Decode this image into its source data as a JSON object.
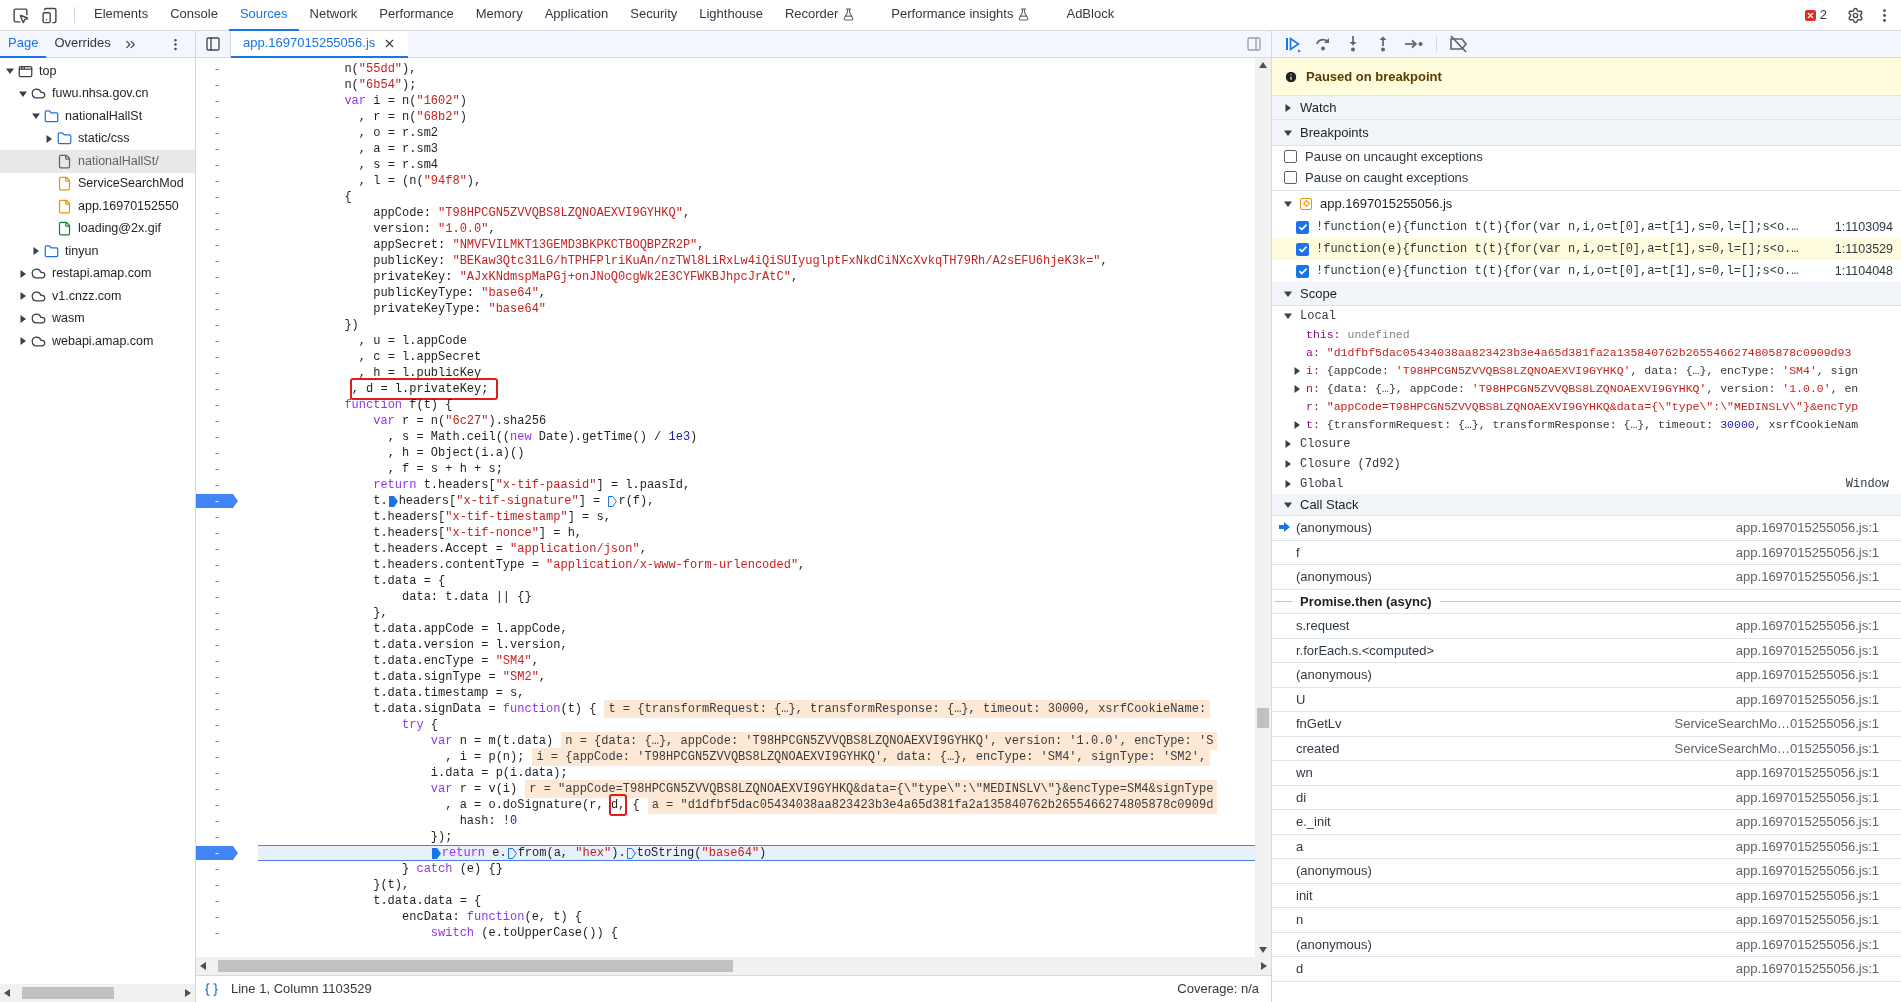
{
  "toolbar": {
    "tabs": [
      {
        "label": "Elements",
        "selected": false,
        "experimental": false
      },
      {
        "label": "Console",
        "selected": false,
        "experimental": false
      },
      {
        "label": "Sources",
        "selected": true,
        "experimental": false
      },
      {
        "label": "Network",
        "selected": false,
        "experimental": false
      },
      {
        "label": "Performance",
        "selected": false,
        "experimental": false
      },
      {
        "label": "Memory",
        "selected": false,
        "experimental": false
      },
      {
        "label": "Application",
        "selected": false,
        "experimental": false
      },
      {
        "label": "Security",
        "selected": false,
        "experimental": false
      },
      {
        "label": "Lighthouse",
        "selected": false,
        "experimental": false
      },
      {
        "label": "Recorder",
        "selected": false,
        "experimental": true
      },
      {
        "label": "Performance insights",
        "selected": false,
        "experimental": true
      },
      {
        "label": "AdBlock",
        "selected": false,
        "experimental": false
      }
    ],
    "error_count": "2"
  },
  "navigator": {
    "tabs": [
      {
        "label": "Page",
        "selected": true
      },
      {
        "label": "Overrides",
        "selected": false
      }
    ],
    "tree": [
      {
        "label": "top",
        "kind": "frame",
        "expanded": true,
        "selected": false,
        "children": [
          {
            "label": "fuwu.nhsa.gov.cn",
            "kind": "domain",
            "expanded": true,
            "selected": false,
            "children": [
              {
                "label": "nationalHallSt",
                "kind": "folder",
                "expanded": true,
                "selected": false,
                "children": [
                  {
                    "label": "static/css",
                    "kind": "folder",
                    "expanded": false,
                    "selected": false
                  },
                  {
                    "label": "nationalHallSt/",
                    "kind": "file",
                    "color": "#5f6368",
                    "selected": true
                  },
                  {
                    "label": "ServiceSearchMod",
                    "kind": "file",
                    "color": "#e8910c",
                    "selected": false
                  },
                  {
                    "label": "app.16970152550",
                    "kind": "file",
                    "color": "#e8910c",
                    "selected": false
                  },
                  {
                    "label": "loading@2x.gif",
                    "kind": "file",
                    "color": "#188038",
                    "selected": false
                  }
                ]
              },
              {
                "label": "tinyun",
                "kind": "folder",
                "expanded": false,
                "selected": false
              }
            ]
          },
          {
            "label": "restapi.amap.com",
            "kind": "domain",
            "expanded": false,
            "selected": false
          },
          {
            "label": "v1.cnzz.com",
            "kind": "domain",
            "expanded": false,
            "selected": false
          },
          {
            "label": "wasm",
            "kind": "domain",
            "expanded": false,
            "selected": false
          },
          {
            "label": "webapi.amap.com",
            "kind": "domain",
            "expanded": false,
            "selected": false
          }
        ]
      }
    ]
  },
  "editor": {
    "file_tab": "app.1697015255056.js",
    "status": "Line 1, Column 1103529",
    "coverage": "Coverage: n/a",
    "lines": [
      {
        "gutter": "-",
        "breakpoint": false,
        "current": false,
        "tokens": [
          {
            "kind": "plain",
            "text": "            n("
          },
          {
            "kind": "string",
            "text": "\"55dd\""
          },
          {
            "kind": "plain",
            "text": "),"
          }
        ]
      },
      {
        "gutter": "-",
        "breakpoint": false,
        "current": false,
        "tokens": [
          {
            "kind": "plain",
            "text": "            n("
          },
          {
            "kind": "string",
            "text": "\"6b54\""
          },
          {
            "kind": "plain",
            "text": ");"
          }
        ]
      },
      {
        "gutter": "-",
        "breakpoint": false,
        "current": false,
        "tokens": [
          {
            "kind": "keyword",
            "text": "            var"
          },
          {
            "kind": "plain",
            "text": " i = n("
          },
          {
            "kind": "string",
            "text": "\"1602\""
          },
          {
            "kind": "plain",
            "text": ")"
          }
        ]
      },
      {
        "gutter": "-",
        "breakpoint": false,
        "current": false,
        "tokens": [
          {
            "kind": "plain",
            "text": "              , r = n("
          },
          {
            "kind": "string",
            "text": "\"68b2\""
          },
          {
            "kind": "plain",
            "text": ")"
          }
        ]
      },
      {
        "gutter": "-",
        "breakpoint": false,
        "current": false,
        "tokens": [
          {
            "kind": "plain",
            "text": "              , o = r.sm2"
          }
        ]
      },
      {
        "gutter": "-",
        "breakpoint": false,
        "current": false,
        "tokens": [
          {
            "kind": "plain",
            "text": "              , a = r.sm3"
          }
        ]
      },
      {
        "gutter": "-",
        "breakpoint": false,
        "current": false,
        "tokens": [
          {
            "kind": "plain",
            "text": "              , s = r.sm4"
          }
        ]
      },
      {
        "gutter": "-",
        "breakpoint": false,
        "current": false,
        "tokens": [
          {
            "kind": "plain",
            "text": "              , l = (n("
          },
          {
            "kind": "string",
            "text": "\"94f8\""
          },
          {
            "kind": "plain",
            "text": "),"
          }
        ]
      },
      {
        "gutter": "-",
        "breakpoint": false,
        "current": false,
        "tokens": [
          {
            "kind": "plain",
            "text": "            {"
          }
        ]
      },
      {
        "gutter": "-",
        "breakpoint": false,
        "current": false,
        "tokens": [
          {
            "kind": "plain",
            "text": "                appCode: "
          },
          {
            "kind": "string",
            "text": "\"T98HPCGN5ZVVQBS8LZQNOAEXVI9GYHKQ\""
          },
          {
            "kind": "plain",
            "text": ","
          }
        ]
      },
      {
        "gutter": "-",
        "breakpoint": false,
        "current": false,
        "tokens": [
          {
            "kind": "plain",
            "text": "                version: "
          },
          {
            "kind": "string",
            "text": "\"1.0.0\""
          },
          {
            "kind": "plain",
            "text": ","
          }
        ]
      },
      {
        "gutter": "-",
        "breakpoint": false,
        "current": false,
        "tokens": [
          {
            "kind": "plain",
            "text": "                appSecret: "
          },
          {
            "kind": "string",
            "text": "\"NMVFVILMKT13GEMD3BKPKCTBOQBPZR2P\""
          },
          {
            "kind": "plain",
            "text": ","
          }
        ]
      },
      {
        "gutter": "-",
        "breakpoint": false,
        "current": false,
        "tokens": [
          {
            "kind": "plain",
            "text": "                publicKey: "
          },
          {
            "kind": "string",
            "text": "\"BEKaw3Qtc31LG/hTPHFPlriKuAn/nzTWl8LiRxLw4iQiSUIyuglptFxNkdCiNXcXvkqTH79Rh/A2sEFU6hjeK3k=\""
          },
          {
            "kind": "plain",
            "text": ","
          }
        ]
      },
      {
        "gutter": "-",
        "breakpoint": false,
        "current": false,
        "tokens": [
          {
            "kind": "plain",
            "text": "                privateKey: "
          },
          {
            "kind": "string",
            "text": "\"AJxKNdmspMaPGj+onJNoQ0cgWk2E3CYFWKBJhpcJrAtC\""
          },
          {
            "kind": "plain",
            "text": ","
          }
        ]
      },
      {
        "gutter": "-",
        "breakpoint": false,
        "current": false,
        "tokens": [
          {
            "kind": "plain",
            "text": "                publicKeyType: "
          },
          {
            "kind": "string",
            "text": "\"base64\""
          },
          {
            "kind": "plain",
            "text": ","
          }
        ]
      },
      {
        "gutter": "-",
        "breakpoint": false,
        "current": false,
        "tokens": [
          {
            "kind": "plain",
            "text": "                privateKeyType: "
          },
          {
            "kind": "string",
            "text": "\"base64\""
          }
        ]
      },
      {
        "gutter": "-",
        "breakpoint": false,
        "current": false,
        "tokens": [
          {
            "kind": "plain",
            "text": "            })"
          }
        ]
      },
      {
        "gutter": "-",
        "breakpoint": false,
        "current": false,
        "tokens": [
          {
            "kind": "plain",
            "text": "              , u = l.appCode"
          }
        ]
      },
      {
        "gutter": "-",
        "breakpoint": false,
        "current": false,
        "tokens": [
          {
            "kind": "plain",
            "text": "              , c = l.appSecret"
          }
        ]
      },
      {
        "gutter": "-",
        "breakpoint": false,
        "current": false,
        "tokens": [
          {
            "kind": "plain",
            "text": "              , h = l.publicKey"
          }
        ]
      },
      {
        "gutter": "-",
        "breakpoint": false,
        "current": false,
        "tokens": [
          {
            "kind": "plain",
            "text": "             , d = l.privateKey; ",
            "boxed": true
          }
        ]
      },
      {
        "gutter": "-",
        "breakpoint": false,
        "current": false,
        "tokens": [
          {
            "kind": "keyword",
            "text": "            function"
          },
          {
            "kind": "plain",
            "text": " f(t) {"
          }
        ]
      },
      {
        "gutter": "-",
        "breakpoint": false,
        "current": false,
        "tokens": [
          {
            "kind": "keyword",
            "text": "                var"
          },
          {
            "kind": "plain",
            "text": " r = n("
          },
          {
            "kind": "string",
            "text": "\"6c27\""
          },
          {
            "kind": "plain",
            "text": ").sha256"
          }
        ]
      },
      {
        "gutter": "-",
        "breakpoint": false,
        "current": false,
        "tokens": [
          {
            "kind": "plain",
            "text": "                  , s = Math.ceil(("
          },
          {
            "kind": "keyword",
            "text": "new"
          },
          {
            "kind": "plain",
            "text": " Date).getTime() / "
          },
          {
            "kind": "number",
            "text": "1e3"
          },
          {
            "kind": "plain",
            "text": ")"
          }
        ]
      },
      {
        "gutter": "-",
        "breakpoint": false,
        "current": false,
        "tokens": [
          {
            "kind": "plain",
            "text": "                  , h = Object(i.a)()"
          }
        ]
      },
      {
        "gutter": "-",
        "breakpoint": false,
        "current": false,
        "tokens": [
          {
            "kind": "plain",
            "text": "                  , f = s + h + s;"
          }
        ]
      },
      {
        "gutter": "-",
        "breakpoint": false,
        "current": false,
        "tokens": [
          {
            "kind": "keyword",
            "text": "                return"
          },
          {
            "kind": "plain",
            "text": " t.headers["
          },
          {
            "kind": "string",
            "text": "\"x-tif-paasid\""
          },
          {
            "kind": "plain",
            "text": "] = l.paasId,"
          }
        ]
      },
      {
        "gutter": "-",
        "breakpoint": true,
        "current": false,
        "tokens": [
          {
            "kind": "plain",
            "text": "                t."
          },
          {
            "kind": "plain",
            "text": "headers[",
            "marker": {
              "active": true
            }
          },
          {
            "kind": "string",
            "text": "\"x-tif-signature\""
          },
          {
            "kind": "plain",
            "text": "] = "
          },
          {
            "kind": "plain",
            "text": "r(f),",
            "marker": {
              "active": false
            }
          }
        ]
      },
      {
        "gutter": "-",
        "breakpoint": false,
        "current": false,
        "tokens": [
          {
            "kind": "plain",
            "text": "                t.headers["
          },
          {
            "kind": "string",
            "text": "\"x-tif-timestamp\""
          },
          {
            "kind": "plain",
            "text": "] = s,"
          }
        ]
      },
      {
        "gutter": "-",
        "breakpoint": false,
        "current": false,
        "tokens": [
          {
            "kind": "plain",
            "text": "                t.headers["
          },
          {
            "kind": "string",
            "text": "\"x-tif-nonce\""
          },
          {
            "kind": "plain",
            "text": "] = h,"
          }
        ]
      },
      {
        "gutter": "-",
        "breakpoint": false,
        "current": false,
        "tokens": [
          {
            "kind": "plain",
            "text": "                t.headers.Accept = "
          },
          {
            "kind": "string",
            "text": "\"application/json\""
          },
          {
            "kind": "plain",
            "text": ","
          }
        ]
      },
      {
        "gutter": "-",
        "breakpoint": false,
        "current": false,
        "tokens": [
          {
            "kind": "plain",
            "text": "                t.headers.contentType = "
          },
          {
            "kind": "string",
            "text": "\"application/x-www-form-urlencoded\""
          },
          {
            "kind": "plain",
            "text": ","
          }
        ]
      },
      {
        "gutter": "-",
        "breakpoint": false,
        "current": false,
        "tokens": [
          {
            "kind": "plain",
            "text": "                t.data = {"
          }
        ]
      },
      {
        "gutter": "-",
        "breakpoint": false,
        "current": false,
        "tokens": [
          {
            "kind": "plain",
            "text": "                    data: t.data || {}"
          }
        ]
      },
      {
        "gutter": "-",
        "breakpoint": false,
        "current": false,
        "tokens": [
          {
            "kind": "plain",
            "text": "                },"
          }
        ]
      },
      {
        "gutter": "-",
        "breakpoint": false,
        "current": false,
        "tokens": [
          {
            "kind": "plain",
            "text": "                t.data.appCode = l.appCode,"
          }
        ]
      },
      {
        "gutter": "-",
        "breakpoint": false,
        "current": false,
        "tokens": [
          {
            "kind": "plain",
            "text": "                t.data.version = l.version,"
          }
        ]
      },
      {
        "gutter": "-",
        "breakpoint": false,
        "current": false,
        "tokens": [
          {
            "kind": "plain",
            "text": "                t.data.encType = "
          },
          {
            "kind": "string",
            "text": "\"SM4\""
          },
          {
            "kind": "plain",
            "text": ","
          }
        ]
      },
      {
        "gutter": "-",
        "breakpoint": false,
        "current": false,
        "tokens": [
          {
            "kind": "plain",
            "text": "                t.data.signType = "
          },
          {
            "kind": "string",
            "text": "\"SM2\""
          },
          {
            "kind": "plain",
            "text": ","
          }
        ]
      },
      {
        "gutter": "-",
        "breakpoint": false,
        "current": false,
        "tokens": [
          {
            "kind": "plain",
            "text": "                t.data.timestamp = s,"
          }
        ]
      },
      {
        "gutter": "-",
        "breakpoint": false,
        "current": false,
        "tokens": [
          {
            "kind": "plain",
            "text": "                t.data.signData = "
          },
          {
            "kind": "keyword",
            "text": "function"
          },
          {
            "kind": "plain",
            "text": "(t) {"
          },
          {
            "kind": "value",
            "text": "t = {transformRequest: {…}, transformResponse: {…}, timeout: 30000, xsrfCookieName:"
          }
        ]
      },
      {
        "gutter": "-",
        "breakpoint": false,
        "current": false,
        "tokens": [
          {
            "kind": "keyword",
            "text": "                    try"
          },
          {
            "kind": "plain",
            "text": " {"
          }
        ]
      },
      {
        "gutter": "-",
        "breakpoint": false,
        "current": false,
        "tokens": [
          {
            "kind": "keyword",
            "text": "                        var"
          },
          {
            "kind": "plain",
            "text": " n = m(t.data)"
          },
          {
            "kind": "value",
            "text": "n = {data: {…}, appCode: 'T98HPCGN5ZVVQBS8LZQNOAEXVI9GYHKQ', version: '1.0.0', encType: 'S"
          }
        ]
      },
      {
        "gutter": "-",
        "breakpoint": false,
        "current": false,
        "tokens": [
          {
            "kind": "plain",
            "text": "                          , i = p(n);"
          },
          {
            "kind": "value",
            "text": "i = {appCode: 'T98HPCGN5ZVVQBS8LZQNOAEXVI9GYHKQ', data: {…}, encType: 'SM4', signType: 'SM2',"
          }
        ]
      },
      {
        "gutter": "-",
        "breakpoint": false,
        "current": false,
        "tokens": [
          {
            "kind": "plain",
            "text": "                        i.data = p(i.data);"
          }
        ]
      },
      {
        "gutter": "-",
        "breakpoint": false,
        "current": false,
        "tokens": [
          {
            "kind": "keyword",
            "text": "                        var"
          },
          {
            "kind": "plain",
            "text": " r = v(i)"
          },
          {
            "kind": "value",
            "text": "r = \"appCode=T98HPCGN5ZVVQBS8LZQNOAEXVI9GYHKQ&data={\\\"type\\\":\\\"MEDINSLV\\\"}&encType=SM4&signType"
          }
        ]
      },
      {
        "gutter": "-",
        "breakpoint": false,
        "current": false,
        "tokens": [
          {
            "kind": "plain",
            "text": "                          , a = o.doSignature(r, "
          },
          {
            "kind": "plain",
            "text": "d,",
            "boxed": true
          },
          {
            "kind": "plain",
            "text": " {"
          },
          {
            "kind": "value",
            "text": "a = \"d1dfbf5dac05434038aa823423b3e4a65d381fa2a135840762b2655466274805878c0909d"
          }
        ]
      },
      {
        "gutter": "-",
        "breakpoint": false,
        "current": false,
        "tokens": [
          {
            "kind": "plain",
            "text": "                            hash: !"
          },
          {
            "kind": "number",
            "text": "0"
          }
        ]
      },
      {
        "gutter": "-",
        "breakpoint": false,
        "current": false,
        "tokens": [
          {
            "kind": "plain",
            "text": "                        });"
          }
        ]
      },
      {
        "gutter": "-",
        "breakpoint": true,
        "current": true,
        "tokens": [
          {
            "kind": "keyword",
            "text": "                        return",
            "marker": {
              "active": true
            }
          },
          {
            "kind": "plain",
            "text": " e."
          },
          {
            "kind": "plain",
            "text": "from(a, ",
            "marker": {
              "active": false
            }
          },
          {
            "kind": "string",
            "text": "\"hex\""
          },
          {
            "kind": "plain",
            "text": ")."
          },
          {
            "kind": "plain",
            "text": "toString(",
            "marker": {
              "active": false
            }
          },
          {
            "kind": "string",
            "text": "\"base64\""
          },
          {
            "kind": "plain",
            "text": ")"
          }
        ]
      },
      {
        "gutter": "-",
        "breakpoint": false,
        "current": false,
        "tokens": [
          {
            "kind": "plain",
            "text": "                    } "
          },
          {
            "kind": "keyword",
            "text": "catch"
          },
          {
            "kind": "plain",
            "text": " (e) {}"
          }
        ]
      },
      {
        "gutter": "-",
        "breakpoint": false,
        "current": false,
        "tokens": [
          {
            "kind": "plain",
            "text": "                }(t),"
          }
        ]
      },
      {
        "gutter": "-",
        "breakpoint": false,
        "current": false,
        "tokens": [
          {
            "kind": "plain",
            "text": "                t.data.data = {"
          }
        ]
      },
      {
        "gutter": "-",
        "breakpoint": false,
        "current": false,
        "tokens": [
          {
            "kind": "plain",
            "text": "                    encData: "
          },
          {
            "kind": "keyword",
            "text": "function"
          },
          {
            "kind": "plain",
            "text": "(e, t) {"
          }
        ]
      },
      {
        "gutter": "-",
        "breakpoint": false,
        "current": false,
        "tokens": [
          {
            "kind": "keyword",
            "text": "                        switch"
          },
          {
            "kind": "plain",
            "text": " (e.toUpperCase()) {"
          }
        ]
      }
    ]
  },
  "debugger": {
    "banner": "Paused on breakpoint",
    "watch": {
      "label": "Watch",
      "expanded": false
    },
    "breakpoints": {
      "label": "Breakpoints",
      "expanded": true,
      "options": [
        {
          "label": "Pause on uncaught exceptions",
          "checked": false
        },
        {
          "label": "Pause on caught exceptions",
          "checked": false
        }
      ],
      "file": {
        "label": "app.1697015255056.js",
        "expanded": true
      },
      "items": [
        {
          "code": "!function(e){function t(t){for(var n,i,o=t[0],a=t[1],s=0,l=[];s<o.…",
          "location": "1:1103094",
          "checked": true,
          "selected": false
        },
        {
          "code": "!function(e){function t(t){for(var n,i,o=t[0],a=t[1],s=0,l=[];s<o.…",
          "location": "1:1103529",
          "checked": true,
          "selected": true
        },
        {
          "code": "!function(e){function t(t){for(var n,i,o=t[0],a=t[1],s=0,l=[];s<o.…",
          "location": "1:1104048",
          "checked": true,
          "selected": false
        }
      ]
    },
    "scope": {
      "label": "Scope",
      "expanded": true,
      "groups": [
        {
          "label": "Local",
          "expanded": true,
          "variables": [
            {
              "name": "this:",
              "kind": "primitive",
              "value": [
                {
                  "kind": "muted",
                  "text": "undefined"
                }
              ]
            },
            {
              "name": "a:",
              "kind": "primitive",
              "value": [
                {
                  "kind": "string",
                  "text": "\"d1dfbf5dac05434038aa823423b3e4a65d381fa2a135840762b2655466274805878c0909d93"
                }
              ]
            },
            {
              "name": "i:",
              "kind": "object",
              "value": [
                {
                  "kind": "plain",
                  "text": "{appCode: "
                },
                {
                  "kind": "string",
                  "text": "'T98HPCGN5ZVVQBS8LZQNOAEXVI9GYHKQ'"
                },
                {
                  "kind": "plain",
                  "text": ", data: {…}, encType: "
                },
                {
                  "kind": "string",
                  "text": "'SM4'"
                },
                {
                  "kind": "plain",
                  "text": ", sign"
                }
              ]
            },
            {
              "name": "n:",
              "kind": "object",
              "value": [
                {
                  "kind": "plain",
                  "text": "{data: {…}, appCode: "
                },
                {
                  "kind": "string",
                  "text": "'T98HPCGN5ZVVQBS8LZQNOAEXVI9GYHKQ'"
                },
                {
                  "kind": "plain",
                  "text": ", version: "
                },
                {
                  "kind": "string",
                  "text": "'1.0.0'"
                },
                {
                  "kind": "plain",
                  "text": ", en"
                }
              ]
            },
            {
              "name": "r:",
              "kind": "primitive",
              "value": [
                {
                  "kind": "string",
                  "text": "\"appCode=T98HPCGN5ZVVQBS8LZQNOAEXVI9GYHKQ&data={\\\"type\\\":\\\"MEDINSLV\\\"}&encTyp"
                }
              ]
            },
            {
              "name": "t:",
              "kind": "object",
              "value": [
                {
                  "kind": "plain",
                  "text": "{transformRequest: {…}, transformResponse: {…}, timeout: "
                },
                {
                  "kind": "number",
                  "text": "30000"
                },
                {
                  "kind": "plain",
                  "text": ", xsrfCookieNam"
                }
              ]
            }
          ]
        },
        {
          "label": "Closure",
          "expanded": false
        },
        {
          "label": "Closure (7d92)",
          "expanded": false
        },
        {
          "label": "Global",
          "expanded": false,
          "value": "Window"
        }
      ]
    },
    "call_stack": {
      "label": "Call Stack",
      "expanded": true,
      "frames": [
        {
          "kind": "frame",
          "name": "(anonymous)",
          "location": "app.1697015255056.js:1",
          "selected": true
        },
        {
          "kind": "frame",
          "name": "f",
          "location": "app.1697015255056.js:1",
          "selected": false
        },
        {
          "kind": "frame",
          "name": "(anonymous)",
          "location": "app.1697015255056.js:1",
          "selected": false
        },
        {
          "kind": "async",
          "name": "Promise.then (async)"
        },
        {
          "kind": "frame",
          "name": "s.request",
          "location": "app.1697015255056.js:1",
          "selected": false
        },
        {
          "kind": "frame",
          "name": "r.forEach.s.<computed>",
          "location": "app.1697015255056.js:1",
          "selected": false
        },
        {
          "kind": "frame",
          "name": "(anonymous)",
          "location": "app.1697015255056.js:1",
          "selected": false
        },
        {
          "kind": "frame",
          "name": "U",
          "location": "app.1697015255056.js:1",
          "selected": false
        },
        {
          "kind": "frame",
          "name": "fnGetLv",
          "location": "ServiceSearchMo…015255056.js:1",
          "selected": false
        },
        {
          "kind": "frame",
          "name": "created",
          "location": "ServiceSearchMo…015255056.js:1",
          "selected": false
        },
        {
          "kind": "frame",
          "name": "wn",
          "location": "app.1697015255056.js:1",
          "selected": false
        },
        {
          "kind": "frame",
          "name": "di",
          "location": "app.1697015255056.js:1",
          "selected": false
        },
        {
          "kind": "frame",
          "name": "e._init",
          "location": "app.1697015255056.js:1",
          "selected": false
        },
        {
          "kind": "frame",
          "name": "a",
          "location": "app.1697015255056.js:1",
          "selected": false
        },
        {
          "kind": "frame",
          "name": "(anonymous)",
          "location": "app.1697015255056.js:1",
          "selected": false
        },
        {
          "kind": "frame",
          "name": "init",
          "location": "app.1697015255056.js:1",
          "selected": false
        },
        {
          "kind": "frame",
          "name": "n",
          "location": "app.1697015255056.js:1",
          "selected": false
        },
        {
          "kind": "frame",
          "name": "(anonymous)",
          "location": "app.1697015255056.js:1",
          "selected": false
        },
        {
          "kind": "frame",
          "name": "d",
          "location": "app.1697015255056.js:1",
          "selected": false
        }
      ]
    }
  }
}
